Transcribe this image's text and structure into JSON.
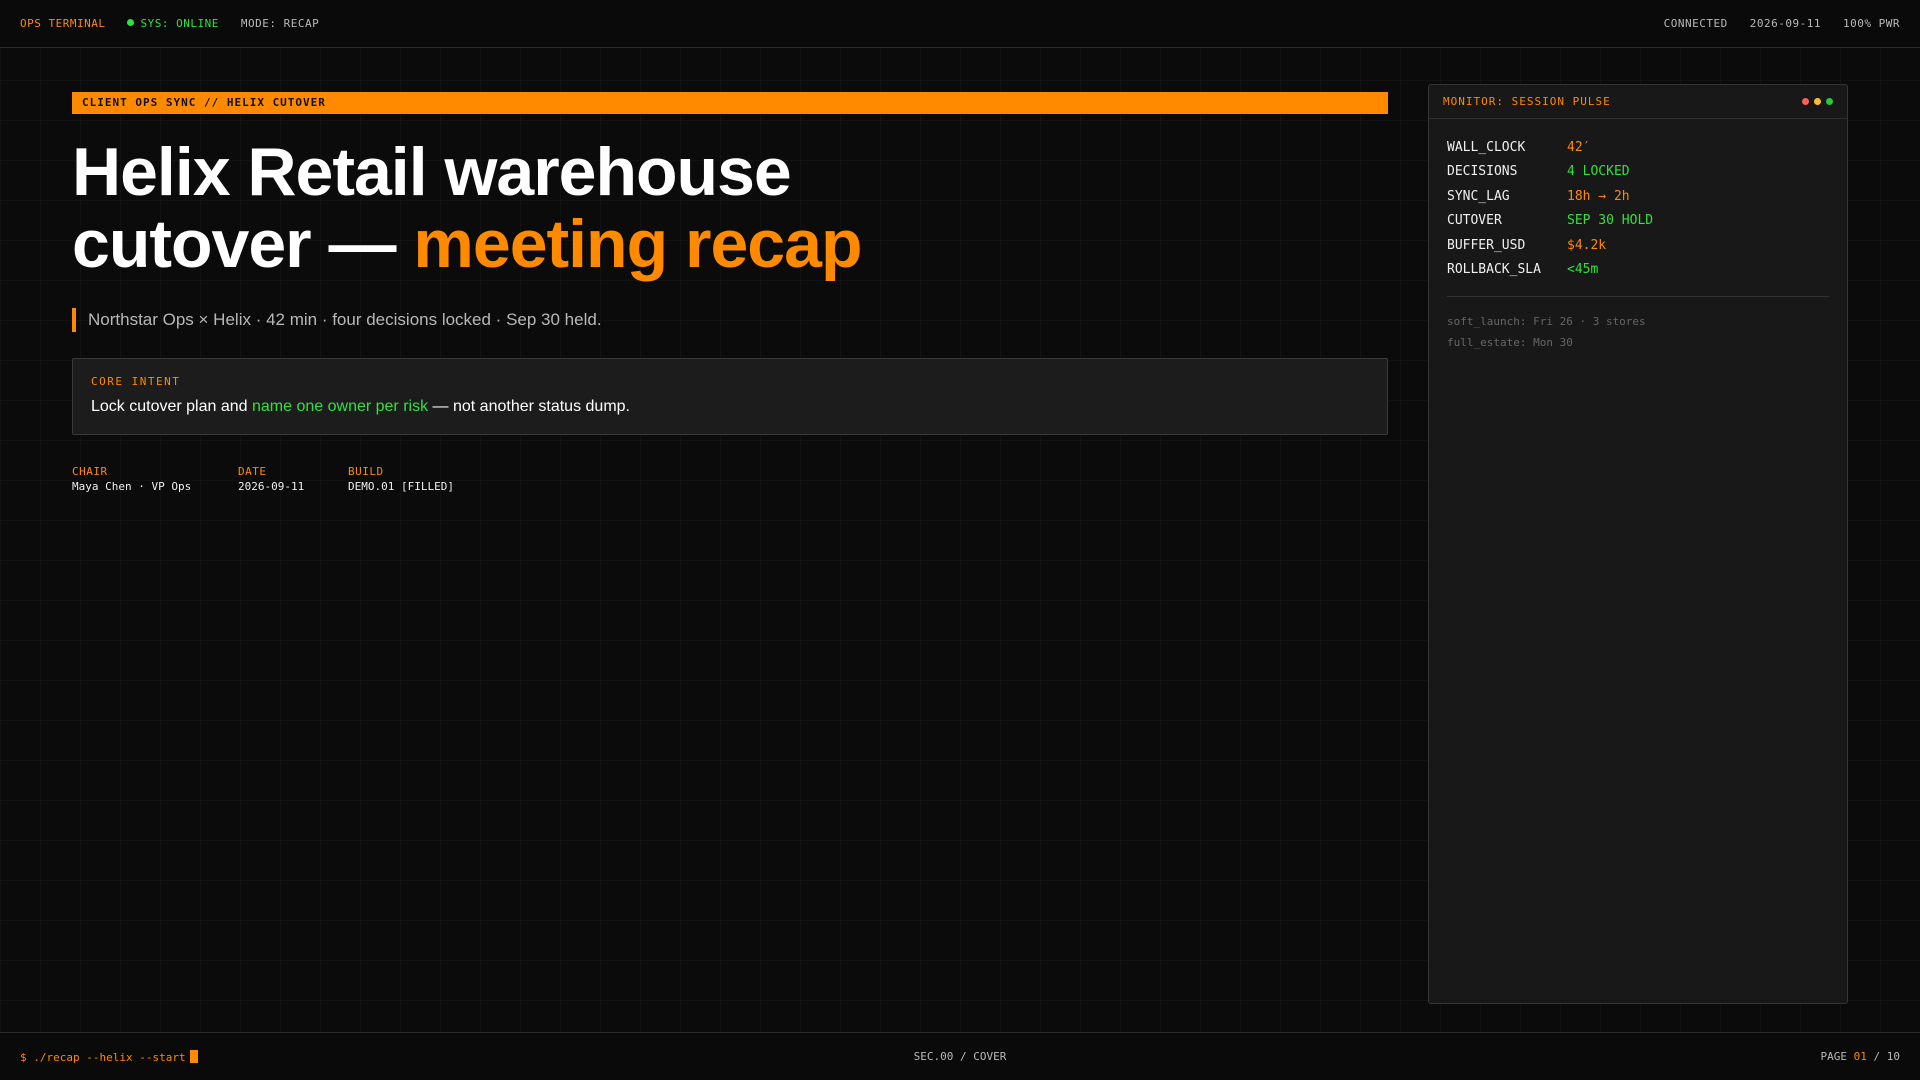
{
  "topbar": {
    "app_title": "OPS TERMINAL",
    "status": "SYS: ONLINE",
    "mode": "MODE: RECAP",
    "connection": "CONNECTED",
    "date": "2026-09-11",
    "power": "100% PWR"
  },
  "banner": "CLIENT OPS SYNC // HELIX CUTOVER",
  "headline": {
    "line1": "Helix Retail warehouse",
    "line2_prefix": "cutover — ",
    "line2_accent": "meeting recap"
  },
  "subline": "Northstar Ops × Helix · 42 min · four decisions locked · Sep 30 held.",
  "intent": {
    "label": "CORE INTENT",
    "prefix": "Lock cutover plan and ",
    "highlight": "name one owner per risk",
    "suffix": " — not another status dump."
  },
  "meta": [
    {
      "key": "CHAIR",
      "value": "Maya Chen · VP Ops"
    },
    {
      "key": "DATE",
      "value": "2026-09-11"
    },
    {
      "key": "BUILD",
      "value": "DEMO.01 [FILLED]"
    }
  ],
  "monitor": {
    "title": "MONITOR: SESSION PULSE",
    "rows": [
      {
        "key": "WALL_CLOCK",
        "value": "42′",
        "color": "#ff8a00"
      },
      {
        "key": "DECISIONS",
        "value": "4 LOCKED",
        "color": "#2fe23a"
      },
      {
        "key": "SYNC_LAG",
        "value": "18h → 2h",
        "color": "#ff8a00"
      },
      {
        "key": "CUTOVER",
        "value": "SEP 30 HOLD",
        "color": "#2fe23a"
      },
      {
        "key": "BUFFER_USD",
        "value": "$4.2k",
        "color": "#ff8a00"
      },
      {
        "key": "ROLLBACK_SLA",
        "value": "<45m",
        "color": "#2fe23a"
      }
    ],
    "notes": [
      "soft_launch: Fri 26 · 3 stores",
      "full_estate: Mon 30"
    ],
    "dot_colors": [
      "#ff5f56",
      "#ffbd2e",
      "#27c93f"
    ]
  },
  "bottombar": {
    "command": "$ ./recap --helix --start",
    "section": "SEC.00 / COVER",
    "page_label": "PAGE",
    "page_current": "01",
    "page_sep": "/",
    "page_total": "10"
  },
  "colors": {
    "accent": "#ff8a00",
    "ok": "#2fe23a",
    "background": "#0b0b0b"
  }
}
